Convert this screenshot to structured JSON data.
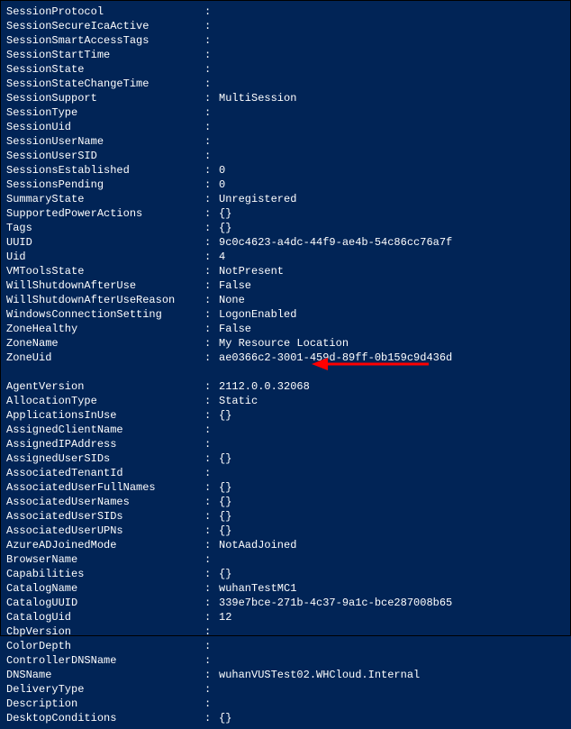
{
  "block1": [
    {
      "key": "SessionProtocol",
      "value": ""
    },
    {
      "key": "SessionSecureIcaActive",
      "value": ""
    },
    {
      "key": "SessionSmartAccessTags",
      "value": ""
    },
    {
      "key": "SessionStartTime",
      "value": ""
    },
    {
      "key": "SessionState",
      "value": ""
    },
    {
      "key": "SessionStateChangeTime",
      "value": ""
    },
    {
      "key": "SessionSupport",
      "value": "MultiSession"
    },
    {
      "key": "SessionType",
      "value": ""
    },
    {
      "key": "SessionUid",
      "value": ""
    },
    {
      "key": "SessionUserName",
      "value": ""
    },
    {
      "key": "SessionUserSID",
      "value": ""
    },
    {
      "key": "SessionsEstablished",
      "value": "0"
    },
    {
      "key": "SessionsPending",
      "value": "0"
    },
    {
      "key": "SummaryState",
      "value": "Unregistered"
    },
    {
      "key": "SupportedPowerActions",
      "value": "{}"
    },
    {
      "key": "Tags",
      "value": "{}"
    },
    {
      "key": "UUID",
      "value": "9c0c4623-a4dc-44f9-ae4b-54c86cc76a7f"
    },
    {
      "key": "Uid",
      "value": "4"
    },
    {
      "key": "VMToolsState",
      "value": "NotPresent"
    },
    {
      "key": "WillShutdownAfterUse",
      "value": "False"
    },
    {
      "key": "WillShutdownAfterUseReason",
      "value": "None"
    },
    {
      "key": "WindowsConnectionSetting",
      "value": "LogonEnabled"
    },
    {
      "key": "ZoneHealthy",
      "value": "False"
    },
    {
      "key": "ZoneName",
      "value": "My Resource Location"
    },
    {
      "key": "ZoneUid",
      "value": "ae0366c2-3001-459d-89ff-0b159c9d436d"
    }
  ],
  "block2": [
    {
      "key": "AgentVersion",
      "value": "2112.0.0.32068"
    },
    {
      "key": "AllocationType",
      "value": "Static"
    },
    {
      "key": "ApplicationsInUse",
      "value": "{}"
    },
    {
      "key": "AssignedClientName",
      "value": ""
    },
    {
      "key": "AssignedIPAddress",
      "value": ""
    },
    {
      "key": "AssignedUserSIDs",
      "value": "{}"
    },
    {
      "key": "AssociatedTenantId",
      "value": ""
    },
    {
      "key": "AssociatedUserFullNames",
      "value": "{}"
    },
    {
      "key": "AssociatedUserNames",
      "value": "{}"
    },
    {
      "key": "AssociatedUserSIDs",
      "value": "{}"
    },
    {
      "key": "AssociatedUserUPNs",
      "value": "{}"
    },
    {
      "key": "AzureADJoinedMode",
      "value": "NotAadJoined"
    },
    {
      "key": "BrowserName",
      "value": ""
    },
    {
      "key": "Capabilities",
      "value": "{}"
    },
    {
      "key": "CatalogName",
      "value": "wuhanTestMC1"
    },
    {
      "key": "CatalogUUID",
      "value": "339e7bce-271b-4c37-9a1c-bce287008b65"
    },
    {
      "key": "CatalogUid",
      "value": "12"
    },
    {
      "key": "CbpVersion",
      "value": ""
    },
    {
      "key": "ColorDepth",
      "value": ""
    },
    {
      "key": "ControllerDNSName",
      "value": ""
    },
    {
      "key": "DNSName",
      "value": "wuhanVUSTest02.WHCloud.Internal"
    },
    {
      "key": "DeliveryType",
      "value": ""
    },
    {
      "key": "Description",
      "value": ""
    },
    {
      "key": "DesktopConditions",
      "value": "{}"
    }
  ]
}
